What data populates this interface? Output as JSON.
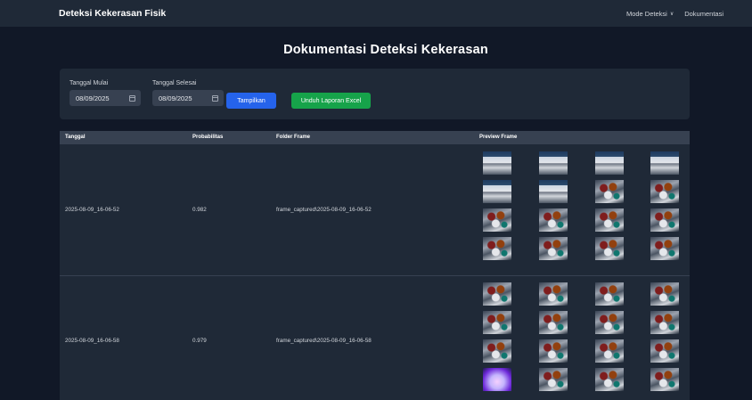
{
  "navbar": {
    "brand": "Deteksi Kekerasan Fisik",
    "menu": [
      {
        "label": "Mode Deteksi",
        "icon": "chevron-down-icon"
      },
      {
        "label": "Dokumentasi"
      }
    ]
  },
  "page": {
    "title": "Dokumentasi Deteksi Kekerasan"
  },
  "filter": {
    "start": {
      "label": "Tanggal Mulai",
      "value": "08/09/2025"
    },
    "end": {
      "label": "Tanggal Selesai",
      "value": "08/09/2025"
    },
    "show_button": "Tampilkan",
    "export_button": "Unduh Laporan Excel"
  },
  "table": {
    "headers": [
      "Tanggal",
      "Probabilitas",
      "Folder Frame",
      "Preview Frame"
    ],
    "rows": [
      {
        "tanggal": "2025-08-09_16-06-52",
        "probabilitas": "0.982",
        "folder": "frame_captured\\2025-08-09_16-06-52",
        "frames": [
          "empty",
          "empty",
          "empty",
          "empty",
          "empty",
          "empty",
          "crowd",
          "crowd",
          "crowd",
          "crowd",
          "crowd",
          "crowd",
          "crowd",
          "crowd",
          "crowd",
          "crowd"
        ]
      },
      {
        "tanggal": "2025-08-09_16-06-58",
        "probabilitas": "0.979",
        "folder": "frame_captured\\2025-08-09_16-06-58",
        "frames": [
          "crowd",
          "crowd",
          "crowd",
          "crowd",
          "crowd",
          "crowd",
          "crowd",
          "crowd",
          "crowd",
          "crowd",
          "crowd",
          "crowd",
          "blur",
          "crowd",
          "crowd",
          "crowd"
        ]
      }
    ]
  },
  "colors": {
    "background": "#111827",
    "navbar": "#1f2937",
    "card": "#1f2937",
    "primary_button": "#2563eb",
    "success_button": "#16a34a"
  }
}
